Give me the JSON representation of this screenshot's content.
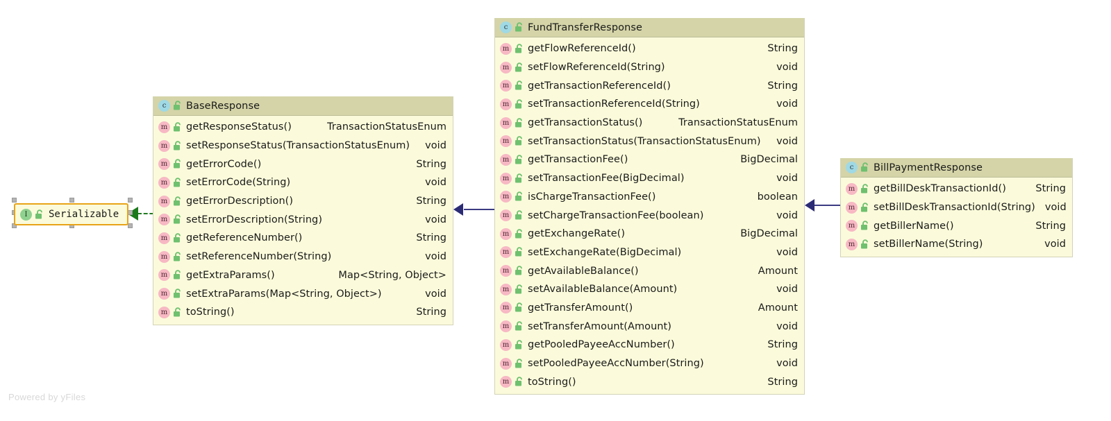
{
  "diagram": {
    "watermark": "Powered by yFiles",
    "colors": {
      "class_header_bg": "#d4d4a8",
      "class_body_bg": "#fbfbdb",
      "class_border": "#d3d3b8",
      "selection_border": "#e8a317",
      "inheritance_edge": "#3a3a82",
      "realization_edge": "#1a7a1a",
      "class_badge": "#9fd9e5",
      "method_badge": "#f7b8c4",
      "interface_badge": "#8fd18f",
      "lock_icon": "#6fc06f"
    },
    "icons": {
      "class": "class-badge-icon",
      "method": "method-badge-icon",
      "interface": "interface-badge-icon",
      "visibility": "unlocked-padlock-icon"
    }
  },
  "nodes": {
    "serializable": {
      "name": "Serializable",
      "kind": "interface",
      "kind_letter": "I",
      "selected": true
    },
    "base_response": {
      "name": "BaseResponse",
      "kind": "class",
      "kind_letter": "c",
      "members": [
        {
          "signature": "getResponseStatus()",
          "type": "TransactionStatusEnum"
        },
        {
          "signature": "setResponseStatus(TransactionStatusEnum)",
          "type": "void"
        },
        {
          "signature": "getErrorCode()",
          "type": "String"
        },
        {
          "signature": "setErrorCode(String)",
          "type": "void"
        },
        {
          "signature": "getErrorDescription()",
          "type": "String"
        },
        {
          "signature": "setErrorDescription(String)",
          "type": "void"
        },
        {
          "signature": "getReferenceNumber()",
          "type": "String"
        },
        {
          "signature": "setReferenceNumber(String)",
          "type": "void"
        },
        {
          "signature": "getExtraParams()",
          "type": "Map<String, Object>"
        },
        {
          "signature": "setExtraParams(Map<String, Object>)",
          "type": "void"
        },
        {
          "signature": "toString()",
          "type": "String"
        }
      ]
    },
    "fund_transfer_response": {
      "name": "FundTransferResponse",
      "kind": "class",
      "kind_letter": "c",
      "members": [
        {
          "signature": "getFlowReferenceId()",
          "type": "String"
        },
        {
          "signature": "setFlowReferenceId(String)",
          "type": "void"
        },
        {
          "signature": "getTransactionReferenceId()",
          "type": "String"
        },
        {
          "signature": "setTransactionReferenceId(String)",
          "type": "void"
        },
        {
          "signature": "getTransactionStatus()",
          "type": "TransactionStatusEnum"
        },
        {
          "signature": "setTransactionStatus(TransactionStatusEnum)",
          "type": "void"
        },
        {
          "signature": "getTransactionFee()",
          "type": "BigDecimal"
        },
        {
          "signature": "setTransactionFee(BigDecimal)",
          "type": "void"
        },
        {
          "signature": "isChargeTransactionFee()",
          "type": "boolean"
        },
        {
          "signature": "setChargeTransactionFee(boolean)",
          "type": "void"
        },
        {
          "signature": "getExchangeRate()",
          "type": "BigDecimal"
        },
        {
          "signature": "setExchangeRate(BigDecimal)",
          "type": "void"
        },
        {
          "signature": "getAvailableBalance()",
          "type": "Amount"
        },
        {
          "signature": "setAvailableBalance(Amount)",
          "type": "void"
        },
        {
          "signature": "getTransferAmount()",
          "type": "Amount"
        },
        {
          "signature": "setTransferAmount(Amount)",
          "type": "void"
        },
        {
          "signature": "getPooledPayeeAccNumber()",
          "type": "String"
        },
        {
          "signature": "setPooledPayeeAccNumber(String)",
          "type": "void"
        },
        {
          "signature": "toString()",
          "type": "String"
        }
      ]
    },
    "bill_payment_response": {
      "name": "BillPaymentResponse",
      "kind": "class",
      "kind_letter": "c",
      "members": [
        {
          "signature": "getBillDeskTransactionId()",
          "type": "String"
        },
        {
          "signature": "setBillDeskTransactionId(String)",
          "type": "void"
        },
        {
          "signature": "getBillerName()",
          "type": "String"
        },
        {
          "signature": "setBillerName(String)",
          "type": "void"
        }
      ]
    }
  },
  "edges": [
    {
      "from": "base_response",
      "to": "serializable",
      "type": "realization",
      "style": "dashed"
    },
    {
      "from": "fund_transfer_response",
      "to": "base_response",
      "type": "generalization",
      "style": "solid"
    },
    {
      "from": "bill_payment_response",
      "to": "fund_transfer_response",
      "type": "generalization",
      "style": "solid"
    }
  ]
}
